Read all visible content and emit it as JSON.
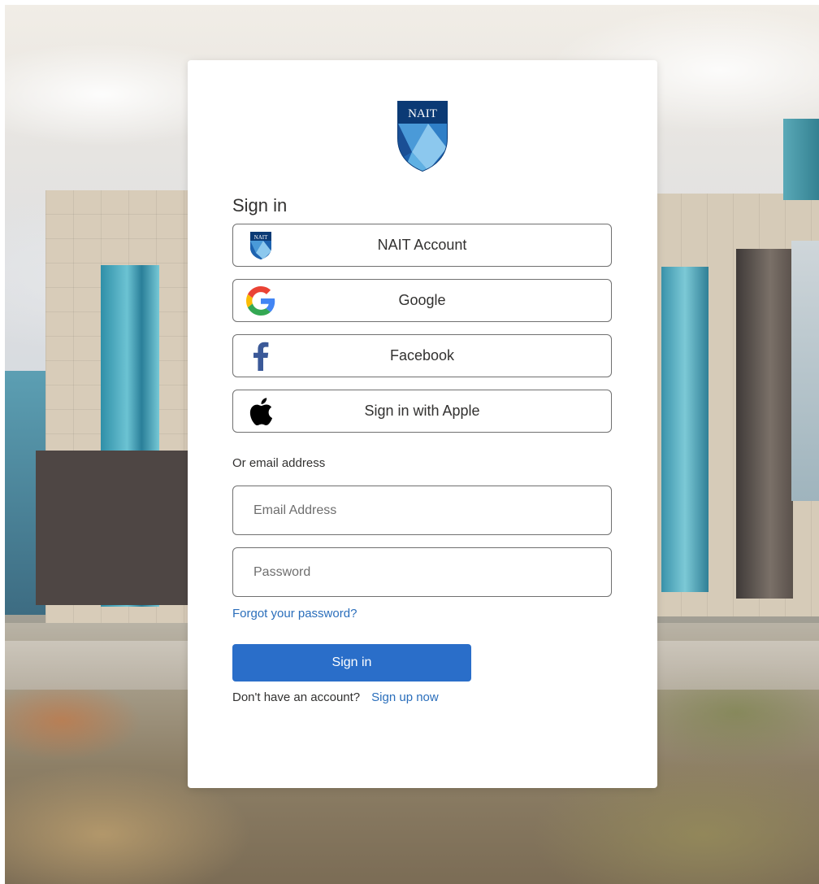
{
  "brand": {
    "logo_text": "NAIT",
    "primary_color": "#2a6ec9",
    "link_color": "#2a6ebb"
  },
  "card": {
    "title": "Sign in"
  },
  "providers": [
    {
      "label": "NAIT Account",
      "icon": "nait-shield-icon"
    },
    {
      "label": "Google",
      "icon": "google-icon"
    },
    {
      "label": "Facebook",
      "icon": "facebook-icon"
    },
    {
      "label": "Sign in with Apple",
      "icon": "apple-icon"
    }
  ],
  "email_section": {
    "label": "Or email address",
    "email_placeholder": "Email Address",
    "email_value": "",
    "password_placeholder": "Password",
    "password_value": "",
    "forgot_link": "Forgot your password?",
    "submit_label": "Sign in",
    "signup_prompt": "Don't have an account?",
    "signup_link": "Sign up now"
  }
}
